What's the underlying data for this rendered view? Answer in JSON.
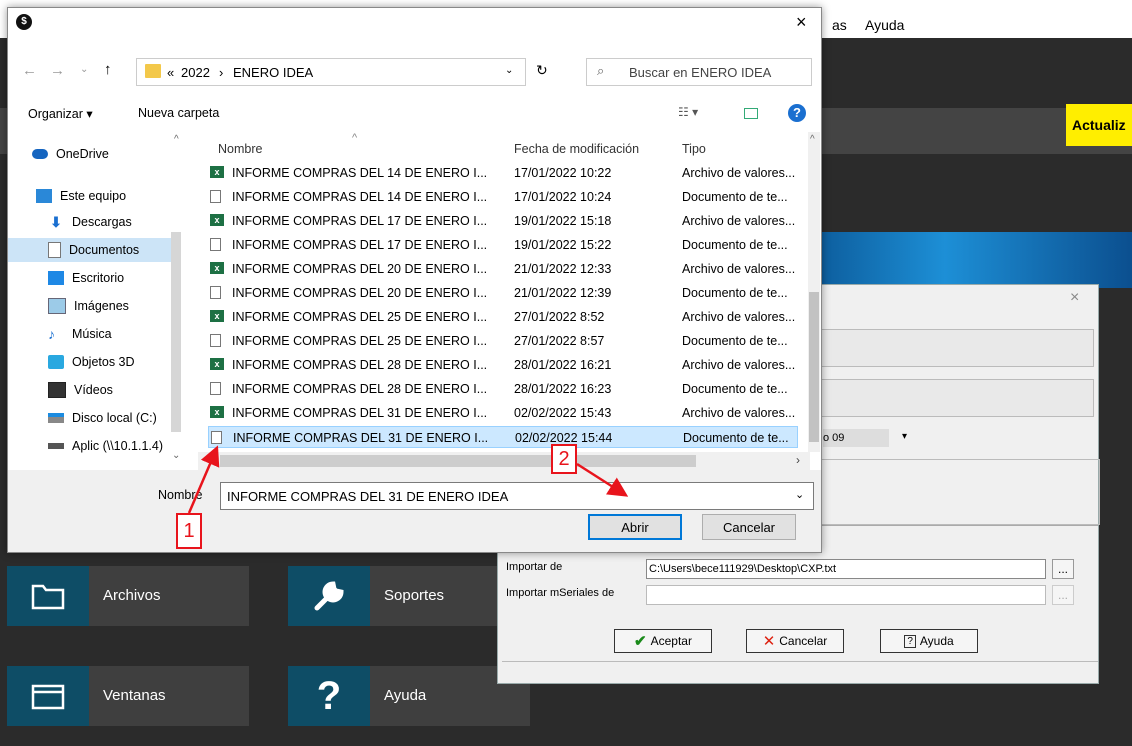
{
  "app": {
    "menu_item_1": "as",
    "menu_item_2": "Ayuda",
    "update_button": "Actualiz"
  },
  "tiles": [
    {
      "label": "Archivos",
      "icon": "folder-icon"
    },
    {
      "label": "Soportes",
      "icon": "wrench-icon"
    },
    {
      "label": "Ventanas",
      "icon": "window-icon"
    },
    {
      "label": "Ayuda",
      "icon": "question-icon"
    }
  ],
  "legacy_dialog": {
    "dropdown_partial": "o 09",
    "import_label": "Importar de",
    "import_value": "C:\\Users\\bece111929\\Desktop\\CXP.txt",
    "import_serials_label": "Importar mSeriales de",
    "import_serials_value": "",
    "browse_label": "...",
    "accept": "Aceptar",
    "cancel": "Cancelar",
    "help": "Ayuda"
  },
  "file_dialog": {
    "close_glyph": "×",
    "breadcrumb": [
      "«",
      "2022",
      "›",
      "ENERO IDEA"
    ],
    "search_placeholder": "Buscar en ENERO IDEA",
    "organize": "Organizar ▾",
    "new_folder": "Nueva carpeta",
    "nav_items": [
      {
        "label": "OneDrive",
        "icon": "cloud-icon"
      },
      {
        "label": "Este equipo",
        "icon": "computer-icon"
      },
      {
        "label": "Descargas",
        "icon": "download-icon"
      },
      {
        "label": "Documentos",
        "icon": "document-icon"
      },
      {
        "label": "Escritorio",
        "icon": "desktop-icon"
      },
      {
        "label": "Imágenes",
        "icon": "images-icon"
      },
      {
        "label": "Música",
        "icon": "music-icon"
      },
      {
        "label": "Objetos 3D",
        "icon": "cube-icon"
      },
      {
        "label": "Vídeos",
        "icon": "video-icon"
      },
      {
        "label": "Disco local (C:)",
        "icon": "drive-icon"
      },
      {
        "label": "Aplic (\\\\10.1.1.4)",
        "icon": "network-drive-icon"
      }
    ],
    "columns": {
      "name": "Nombre",
      "date": "Fecha de modificación",
      "type": "Tipo"
    },
    "files": [
      {
        "name": "INFORME COMPRAS DEL 14 DE ENERO I...",
        "date": "17/01/2022 10:22",
        "type": "Archivo de valores...",
        "kind": "xls"
      },
      {
        "name": "INFORME COMPRAS DEL 14 DE ENERO I...",
        "date": "17/01/2022 10:24",
        "type": "Documento de te...",
        "kind": "txt"
      },
      {
        "name": "INFORME COMPRAS DEL 17 DE ENERO I...",
        "date": "19/01/2022 15:18",
        "type": "Archivo de valores...",
        "kind": "xls"
      },
      {
        "name": "INFORME COMPRAS DEL 17 DE ENERO I...",
        "date": "19/01/2022 15:22",
        "type": "Documento de te...",
        "kind": "txt"
      },
      {
        "name": "INFORME COMPRAS DEL 20 DE ENERO I...",
        "date": "21/01/2022 12:33",
        "type": "Archivo de valores...",
        "kind": "xls"
      },
      {
        "name": "INFORME COMPRAS DEL 20 DE ENERO I...",
        "date": "21/01/2022 12:39",
        "type": "Documento de te...",
        "kind": "txt"
      },
      {
        "name": "INFORME COMPRAS DEL 25 DE ENERO I...",
        "date": "27/01/2022 8:52",
        "type": "Archivo de valores...",
        "kind": "xls"
      },
      {
        "name": "INFORME COMPRAS DEL 25 DE ENERO I...",
        "date": "27/01/2022 8:57",
        "type": "Documento de te...",
        "kind": "txt"
      },
      {
        "name": "INFORME COMPRAS DEL 28 DE ENERO I...",
        "date": "28/01/2022 16:21",
        "type": "Archivo de valores...",
        "kind": "xls"
      },
      {
        "name": "INFORME COMPRAS DEL 28 DE ENERO I...",
        "date": "28/01/2022 16:23",
        "type": "Documento de te...",
        "kind": "txt"
      },
      {
        "name": "INFORME COMPRAS DEL 31 DE ENERO I...",
        "date": "02/02/2022 15:43",
        "type": "Archivo de valores...",
        "kind": "xls"
      },
      {
        "name": "INFORME COMPRAS DEL 31 DE ENERO I...",
        "date": "02/02/2022 15:44",
        "type": "Documento de te...",
        "kind": "txt",
        "selected": true
      }
    ],
    "filename_label": "Nombre",
    "filename_value": "INFORME COMPRAS DEL 31 DE ENERO IDEA",
    "open": "Abrir",
    "cancel": "Cancelar"
  },
  "callouts": {
    "one": "1",
    "two": "2"
  },
  "colors": {
    "accent_yellow": "#ffee00",
    "selection": "#cce8ff",
    "callout_red": "#e8141c",
    "tile_teal": "#0e4d66"
  }
}
